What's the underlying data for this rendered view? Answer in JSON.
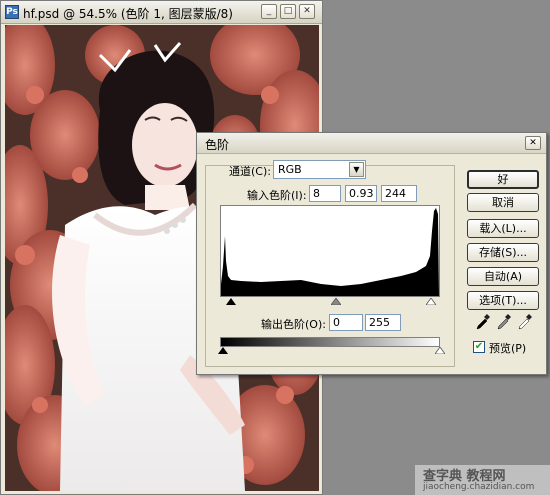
{
  "document_window": {
    "title": "hf.psd @ 54.5% (色阶 1, 图层蒙版/8)",
    "icon": "ps-document-icon",
    "controls": [
      "minimize",
      "maximize",
      "close"
    ]
  },
  "levels_dialog": {
    "title": "色阶",
    "channel_label": "通道(C):",
    "channel_value": "RGB",
    "input_label": "输入色阶(I):",
    "input_values": [
      "8",
      "0.93",
      "244"
    ],
    "output_label": "输出色阶(O):",
    "output_values": [
      "0",
      "255"
    ],
    "buttons": {
      "ok": "好",
      "cancel": "取消",
      "load": "载入(L)...",
      "save": "存储(S)...",
      "auto": "自动(A)",
      "options": "选项(T)..."
    },
    "preview_label": "预览(P)",
    "preview_checked": true,
    "eyedroppers": [
      "black-point-eyedropper-icon",
      "gray-point-eyedropper-icon",
      "white-point-eyedropper-icon"
    ]
  },
  "watermark": {
    "line1": "查字典 教程网",
    "line2": "jiaocheng.chazidian.com"
  },
  "colors": {
    "window_bg": "#ece9d8",
    "workspace": "#8b8b8b",
    "foliage": "#c8685a"
  }
}
